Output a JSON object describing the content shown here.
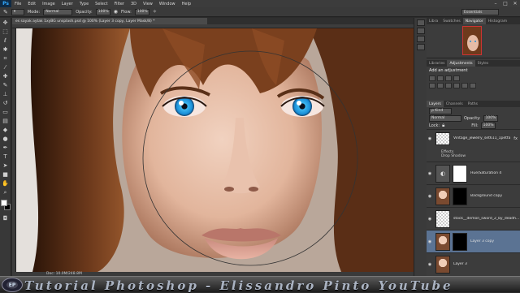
{
  "app": {
    "logo": "Ps",
    "menu": [
      "File",
      "Edit",
      "Image",
      "Layer",
      "Type",
      "Select",
      "Filter",
      "3D",
      "View",
      "Window",
      "Help"
    ],
    "window_controls": [
      "–",
      "□",
      "✕"
    ]
  },
  "options_bar": {
    "mode_label": "Mode:",
    "mode_value": "Normal",
    "opacity_label": "Opacity:",
    "opacity_value": "100%",
    "flow_label": "Flow:",
    "flow_value": "100%",
    "workspace": "Essentials"
  },
  "document": {
    "tab_title": "es sayak aytak 1xyBG unsplash.psd @ 100% (Layer 3 copy, Layer Mask/8) *",
    "status": "Doc: 10.0M/248.8M"
  },
  "panels": {
    "top_tabs": [
      "Libra",
      "Swatches",
      "Navigator",
      "Histogram"
    ],
    "adjust_tabs": [
      "Libraries",
      "Adjustments",
      "Styles"
    ],
    "adjust_title": "Add an adjustment",
    "layer_tabs": [
      "Layers",
      "Channels",
      "Paths"
    ],
    "kind_label": "ρ Kind",
    "blend_mode": "Normal",
    "opacity_label": "Opacity:",
    "opacity_value": "100%",
    "lock_label": "Lock:",
    "fill_label": "Fill:",
    "fill_value": "100%"
  },
  "layers": [
    {
      "name": "Vintage_jewelry_set611_1petfa",
      "thumb": "checker",
      "fx": "fx"
    },
    {
      "name": "Hue/Saturation 4",
      "thumb": "adj",
      "mask": "white"
    },
    {
      "name": "Background copy",
      "thumb": "photo",
      "mask": "black"
    },
    {
      "name": "stock__demon_sword_2_by_deadh...",
      "thumb": "checker"
    },
    {
      "name": "Layer 3 copy",
      "thumb": "photo",
      "mask": "black",
      "selected": true
    },
    {
      "name": "Layer 3",
      "thumb": "photo"
    }
  ],
  "effects": {
    "label": "Effects",
    "item": "Drop Shadow"
  },
  "banner": {
    "text": "Tutorial Photoshop - Elissandro Pinto  YouTube"
  }
}
